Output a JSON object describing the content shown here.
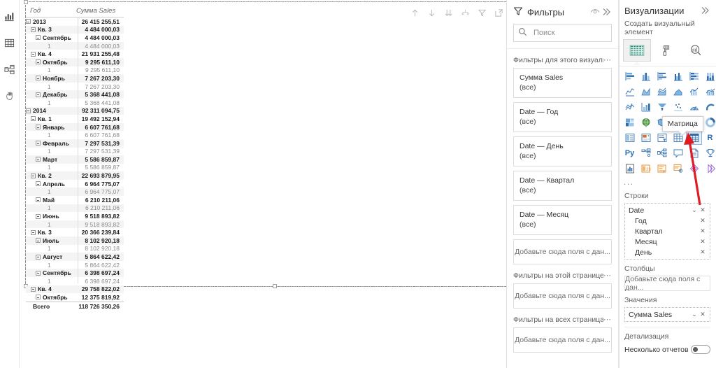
{
  "rail": {
    "items": [
      {
        "name": "report-view",
        "icon": "bar-chart-icon"
      },
      {
        "name": "data-view",
        "icon": "table-icon"
      },
      {
        "name": "model-view",
        "icon": "model-icon"
      },
      {
        "name": "paint-view",
        "icon": "hand-icon"
      }
    ]
  },
  "visual": {
    "toolbar": [
      {
        "name": "drill-up-button",
        "icon": "arrow-up-icon"
      },
      {
        "name": "drill-down-button",
        "icon": "arrow-down-icon"
      },
      {
        "name": "expand-all-button",
        "icon": "double-arrow-down-icon"
      },
      {
        "name": "drill-mode-button",
        "icon": "drill-fork-icon"
      },
      {
        "name": "filter-button",
        "icon": "funnel-icon"
      },
      {
        "name": "focus-mode-button",
        "icon": "focus-icon"
      },
      {
        "name": "more-options-button",
        "icon": "ellipsis-icon"
      }
    ],
    "matrix": {
      "columns": [
        "Год",
        "Сумма Sales"
      ],
      "total_label": "Всего",
      "total_value": "118 726 350,26",
      "rows": [
        {
          "label": "2013",
          "value": "26 415 255,51",
          "level": 0,
          "expandable": true,
          "bold": true
        },
        {
          "label": "Кв. 3",
          "value": "4 484 000,03",
          "level": 1,
          "expandable": true,
          "bold": true
        },
        {
          "label": "Сентябрь",
          "value": "4 484 000,03",
          "level": 2,
          "expandable": true,
          "bold": true
        },
        {
          "label": "1",
          "value": "4 484 000,03",
          "level": 3,
          "expandable": false,
          "bold": false
        },
        {
          "label": "Кв. 4",
          "value": "21 931 255,48",
          "level": 1,
          "expandable": true,
          "bold": true
        },
        {
          "label": "Октябрь",
          "value": "9 295 611,10",
          "level": 2,
          "expandable": true,
          "bold": true
        },
        {
          "label": "1",
          "value": "9 295 611,10",
          "level": 3,
          "expandable": false,
          "bold": false
        },
        {
          "label": "Ноябрь",
          "value": "7 267 203,30",
          "level": 2,
          "expandable": true,
          "bold": true
        },
        {
          "label": "1",
          "value": "7 267 203,30",
          "level": 3,
          "expandable": false,
          "bold": false
        },
        {
          "label": "Декабрь",
          "value": "5 368 441,08",
          "level": 2,
          "expandable": true,
          "bold": true
        },
        {
          "label": "1",
          "value": "5 368 441,08",
          "level": 3,
          "expandable": false,
          "bold": false
        },
        {
          "label": "2014",
          "value": "92 311 094,75",
          "level": 0,
          "expandable": true,
          "bold": true
        },
        {
          "label": "Кв. 1",
          "value": "19 492 152,94",
          "level": 1,
          "expandable": true,
          "bold": true
        },
        {
          "label": "Январь",
          "value": "6 607 761,68",
          "level": 2,
          "expandable": true,
          "bold": true
        },
        {
          "label": "1",
          "value": "6 607 761,68",
          "level": 3,
          "expandable": false,
          "bold": false
        },
        {
          "label": "Февраль",
          "value": "7 297 531,39",
          "level": 2,
          "expandable": true,
          "bold": true
        },
        {
          "label": "1",
          "value": "7 297 531,39",
          "level": 3,
          "expandable": false,
          "bold": false
        },
        {
          "label": "Март",
          "value": "5 586 859,87",
          "level": 2,
          "expandable": true,
          "bold": true
        },
        {
          "label": "1",
          "value": "5 586 859,87",
          "level": 3,
          "expandable": false,
          "bold": false
        },
        {
          "label": "Кв. 2",
          "value": "22 693 879,95",
          "level": 1,
          "expandable": true,
          "bold": true
        },
        {
          "label": "Апрель",
          "value": "6 964 775,07",
          "level": 2,
          "expandable": true,
          "bold": true
        },
        {
          "label": "1",
          "value": "6 964 775,07",
          "level": 3,
          "expandable": false,
          "bold": false
        },
        {
          "label": "Май",
          "value": "6 210 211,06",
          "level": 2,
          "expandable": true,
          "bold": true
        },
        {
          "label": "1",
          "value": "6 210 211,06",
          "level": 3,
          "expandable": false,
          "bold": false
        },
        {
          "label": "Июнь",
          "value": "9 518 893,82",
          "level": 2,
          "expandable": true,
          "bold": true
        },
        {
          "label": "1",
          "value": "9 518 893,82",
          "level": 3,
          "expandable": false,
          "bold": false
        },
        {
          "label": "Кв. 3",
          "value": "20 366 239,84",
          "level": 1,
          "expandable": true,
          "bold": true
        },
        {
          "label": "Июль",
          "value": "8 102 920,18",
          "level": 2,
          "expandable": true,
          "bold": true
        },
        {
          "label": "1",
          "value": "8 102 920,18",
          "level": 3,
          "expandable": false,
          "bold": false
        },
        {
          "label": "Август",
          "value": "5 864 622,42",
          "level": 2,
          "expandable": true,
          "bold": true
        },
        {
          "label": "1",
          "value": "5 864 622,42",
          "level": 3,
          "expandable": false,
          "bold": false
        },
        {
          "label": "Сентябрь",
          "value": "6 398 697,24",
          "level": 2,
          "expandable": true,
          "bold": true
        },
        {
          "label": "1",
          "value": "6 398 697,24",
          "level": 3,
          "expandable": false,
          "bold": false
        },
        {
          "label": "Кв. 4",
          "value": "29 758 822,02",
          "level": 1,
          "expandable": true,
          "bold": true
        },
        {
          "label": "Октябрь",
          "value": "12 375 819,92",
          "level": 2,
          "expandable": true,
          "bold": true
        }
      ]
    }
  },
  "filters": {
    "title": "Фильтры",
    "hide_icon": "eye-icon",
    "collapse_icon": "chevron-double-right-icon",
    "search_placeholder": "Поиск",
    "search_value": "",
    "sections": [
      {
        "label": "Фильтры для этого визуальн...",
        "cards": [
          {
            "name": "Сумма Sales",
            "state": "(все)"
          },
          {
            "name": "Date — Год",
            "state": "(все)"
          },
          {
            "name": "Date — День",
            "state": "(все)"
          },
          {
            "name": "Date — Квартал",
            "state": "(все)"
          },
          {
            "name": "Date — Месяц",
            "state": "(все)"
          }
        ],
        "dropzone": "Добавьте сюда поля с дан..."
      },
      {
        "label": "Фильтры на этой странице",
        "cards": [],
        "dropzone": "Добавьте сюда поля с дан..."
      },
      {
        "label": "Фильтры на всех страницах",
        "cards": [],
        "dropzone": "Добавьте сюда поля с дан..."
      }
    ]
  },
  "visualizations": {
    "title": "Визуализации",
    "collapse_icon": "chevron-double-right-icon",
    "subtitle": "Создать визуальный элемент",
    "top_buttons": [
      {
        "name": "build-visual-tab",
        "icon": "build-fields-icon",
        "selected": true
      },
      {
        "name": "format-visual-tab",
        "icon": "paint-roller-icon",
        "selected": false
      },
      {
        "name": "analytics-tab",
        "icon": "magnifier-chart-icon",
        "selected": false
      }
    ],
    "tooltip": "Матрица",
    "icons": [
      {
        "name": "stacked-bar-chart-icon",
        "glyph": "bar-h-stack",
        "selected": false
      },
      {
        "name": "stacked-column-chart-icon",
        "glyph": "col-stack",
        "selected": false
      },
      {
        "name": "clustered-bar-chart-icon",
        "glyph": "bar-h-clust",
        "selected": false
      },
      {
        "name": "clustered-column-chart-icon",
        "glyph": "col-clust",
        "selected": false
      },
      {
        "name": "100-stacked-bar-chart-icon",
        "glyph": "bar-h-100",
        "selected": false
      },
      {
        "name": "100-stacked-column-chart-icon",
        "glyph": "col-100",
        "selected": false
      },
      {
        "name": "line-chart-icon",
        "glyph": "line",
        "selected": false
      },
      {
        "name": "area-chart-icon",
        "glyph": "area",
        "selected": false
      },
      {
        "name": "stacked-area-chart-icon",
        "glyph": "area-stack",
        "selected": false
      },
      {
        "name": "line-stacked-column-icon",
        "glyph": "area-fill",
        "selected": false
      },
      {
        "name": "line-clustered-column-icon",
        "glyph": "combo-1",
        "selected": false
      },
      {
        "name": "ribbon-chart-icon",
        "glyph": "combo-2",
        "selected": false
      },
      {
        "name": "waterfall-chart-icon",
        "glyph": "waterfall",
        "selected": false
      },
      {
        "name": "scatter-chart-icon",
        "glyph": "scatter",
        "selected": false
      },
      {
        "name": "funnel-chart-icon",
        "glyph": "funnel",
        "selected": false
      },
      {
        "name": "dot-plot-icon",
        "glyph": "dotplot",
        "selected": false
      },
      {
        "name": "gauge-chart-icon",
        "glyph": "gauge",
        "selected": false
      },
      {
        "name": "kpi-arc-icon",
        "glyph": "arc",
        "selected": false
      },
      {
        "name": "treemap-icon",
        "glyph": "treemap",
        "selected": false
      },
      {
        "name": "map-icon",
        "glyph": "globe",
        "selected": false
      },
      {
        "name": "filled-map-icon",
        "glyph": "shapemap",
        "selected": false
      },
      {
        "name": "azure-map-icon",
        "glyph": "azuremap",
        "selected": false
      },
      {
        "name": "pie-chart-icon",
        "glyph": "pie",
        "selected": false
      },
      {
        "name": "donut-chart-icon",
        "glyph": "donut",
        "selected": false
      },
      {
        "name": "multi-row-card-icon",
        "glyph": "multirow",
        "selected": false
      },
      {
        "name": "kpi-icon",
        "glyph": "kpi",
        "selected": false
      },
      {
        "name": "slicer-icon",
        "glyph": "slicer",
        "selected": false
      },
      {
        "name": "table-icon",
        "glyph": "table",
        "selected": false
      },
      {
        "name": "matrix-icon",
        "glyph": "matrix",
        "selected": true
      },
      {
        "name": "r-script-visual-icon",
        "glyph": "R",
        "selected": false
      },
      {
        "name": "python-visual-icon",
        "glyph": "Py",
        "selected": false
      },
      {
        "name": "decomposition-tree-icon",
        "glyph": "decomp",
        "selected": false
      },
      {
        "name": "key-influencers-icon",
        "glyph": "influencer",
        "selected": false
      },
      {
        "name": "smart-narrative-icon",
        "glyph": "narrative",
        "selected": false
      },
      {
        "name": "paginated-report-icon",
        "glyph": "paginated",
        "selected": false
      },
      {
        "name": "powerapps-icon",
        "glyph": "trophy",
        "selected": false
      },
      {
        "name": "power-automate-icon",
        "glyph": "report",
        "selected": false
      },
      {
        "name": "visio-visual-icon",
        "glyph": "orange1",
        "selected": false
      },
      {
        "name": "arcgis-maps-icon",
        "glyph": "orange2",
        "selected": false
      },
      {
        "name": "text-filter-icon",
        "glyph": "orange3",
        "selected": false
      },
      {
        "name": "get-more-visuals-icon",
        "glyph": "diamond1",
        "selected": false
      },
      {
        "name": "import-visual-icon",
        "glyph": "diamond2",
        "selected": false
      }
    ],
    "more_label": "...",
    "wells": [
      {
        "title": "Строки",
        "type": "fields",
        "items": [
          {
            "label": "Date",
            "child": false,
            "chevron": true,
            "remove": true
          },
          {
            "label": "Год",
            "child": true,
            "chevron": false,
            "remove": true
          },
          {
            "label": "Квартал",
            "child": true,
            "chevron": false,
            "remove": true
          },
          {
            "label": "Месяц",
            "child": true,
            "chevron": false,
            "remove": true
          },
          {
            "label": "День",
            "child": true,
            "chevron": false,
            "remove": true
          }
        ]
      },
      {
        "title": "Столбцы",
        "type": "drop",
        "dropzone": "Добавьте сюда поля с дан..."
      },
      {
        "title": "Значения",
        "type": "fields",
        "items": [
          {
            "label": "Сумма Sales",
            "child": false,
            "chevron": true,
            "remove": true
          }
        ]
      }
    ],
    "drillthrough": {
      "title": "Детализация",
      "toggle_label": "Несколько отчетов",
      "toggle_on": false
    }
  },
  "colors": {
    "accent_blue": "#2c6fb5",
    "selected_icon_bg": "#e9f2fb",
    "arrow_red": "#e01b24",
    "panel_border": "#e1e1e1",
    "row_alt": "#f4f4f4"
  }
}
